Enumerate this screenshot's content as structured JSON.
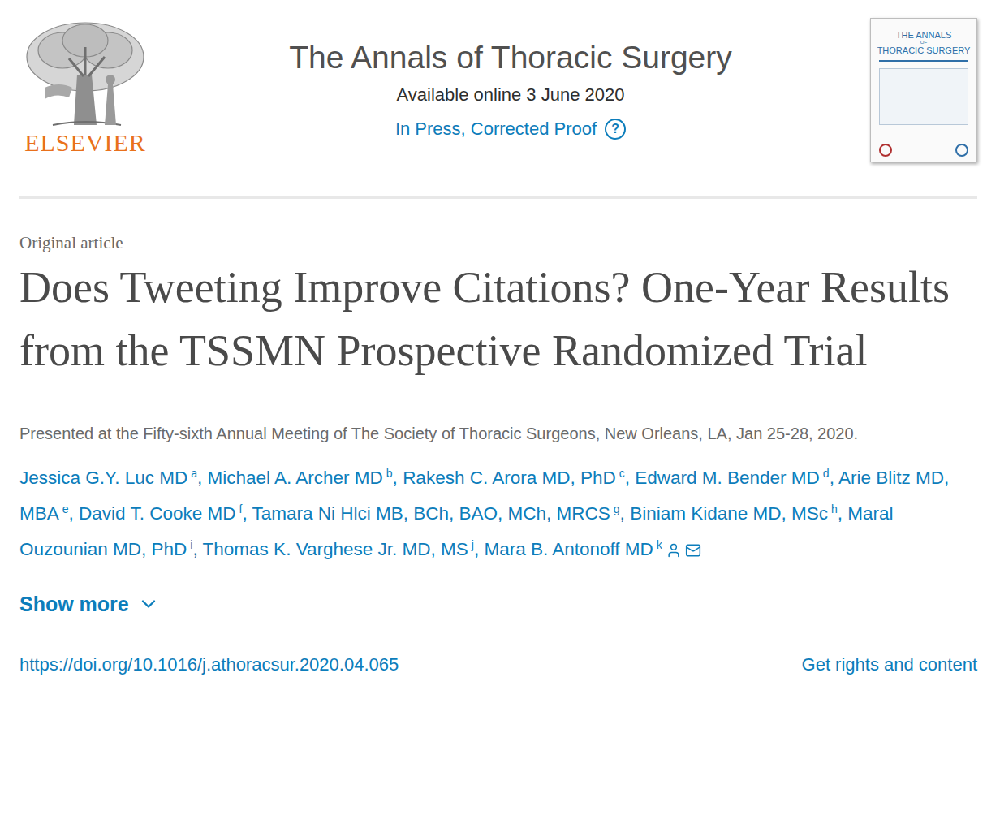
{
  "header": {
    "publisher": "ELSEVIER",
    "journal": "The Annals of Thoracic Surgery",
    "available": "Available online 3 June 2020",
    "status": "In Press, Corrected Proof",
    "help_icon": "?",
    "cover": {
      "title_lines": [
        "THE ANNALS",
        "OF",
        "THORACIC SURGERY"
      ]
    }
  },
  "article": {
    "type": "Original article",
    "title": "Does Tweeting Improve Citations? One-Year Results from the TSSMN Prospective Randomized Trial",
    "note": "Presented at the Fifty-sixth Annual Meeting of The Society of Thoracic Surgeons, New Orleans, LA, Jan 25-28, 2020.",
    "author_separator": ", ",
    "authors": [
      {
        "name": "Jessica G.Y. Luc MD",
        "affiliation": "a",
        "corresponding": false
      },
      {
        "name": "Michael A. Archer MD",
        "affiliation": "b",
        "corresponding": false
      },
      {
        "name": "Rakesh C. Arora MD, PhD",
        "affiliation": "c",
        "corresponding": false
      },
      {
        "name": "Edward M. Bender MD",
        "affiliation": "d",
        "corresponding": false
      },
      {
        "name": "Arie Blitz MD, MBA",
        "affiliation": "e",
        "corresponding": false
      },
      {
        "name": "David T. Cooke MD",
        "affiliation": "f",
        "corresponding": false
      },
      {
        "name": "Tamara Ni Hlci MB, BCh, BAO, MCh, MRCS",
        "affiliation": "g",
        "corresponding": false
      },
      {
        "name": "Biniam Kidane MD, MSc",
        "affiliation": "h",
        "corresponding": false
      },
      {
        "name": "Maral Ouzounian MD, PhD",
        "affiliation": "i",
        "corresponding": false
      },
      {
        "name": "Thomas K. Varghese Jr. MD, MS",
        "affiliation": "j",
        "corresponding": false
      },
      {
        "name": "Mara B. Antonoff MD",
        "affiliation": "k",
        "corresponding": true
      }
    ],
    "show_more": "Show more",
    "doi": "https://doi.org/10.1016/j.athoracsur.2020.04.065",
    "rights": "Get rights and content"
  }
}
